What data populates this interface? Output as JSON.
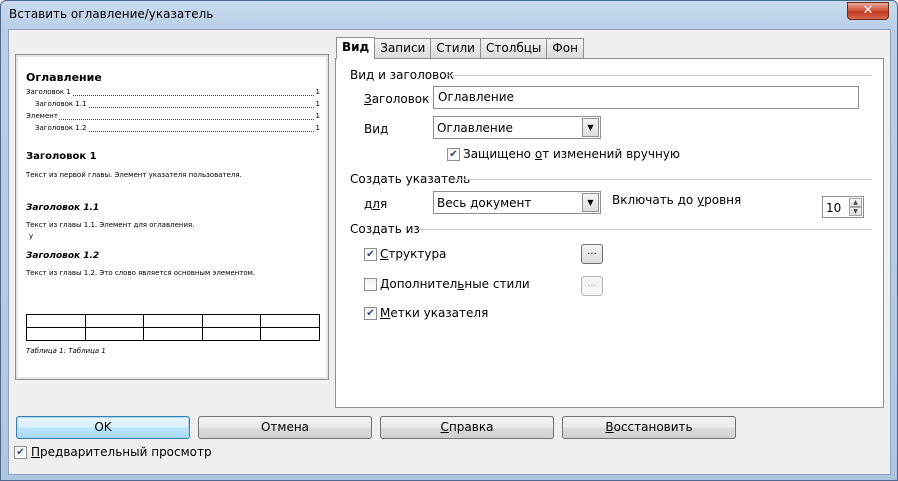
{
  "window": {
    "title": "Вставить оглавление/указатель",
    "close_glyph": "✕"
  },
  "preview": {
    "title": "Оглавление",
    "toc": [
      {
        "text": "Заголовок 1",
        "page": "1",
        "indent": 0
      },
      {
        "text": "Заголовок 1.1",
        "page": "1",
        "indent": 1
      },
      {
        "text": "Элемент",
        "page": "1",
        "indent": 0
      },
      {
        "text": "Заголовок 1.2",
        "page": "1",
        "indent": 1
      }
    ],
    "heading1": "Заголовок 1",
    "para1": "Текст из первой главы. Элемент указателя пользователя.",
    "heading11": "Заголовок 1.1",
    "para11": "Текст из главы 1.1. Элемент для оглавления.",
    "para11_marker": "у",
    "heading12": "Заголовок 1.2",
    "para12": "Текст из главы 1.2. Это слово является основным элементом.",
    "table_caption": "Таблица 1: Таблица 1"
  },
  "tabs": [
    "Вид",
    "Записи",
    "Стили",
    "Столбцы",
    "Фон"
  ],
  "active_tab": "Вид",
  "type_section": {
    "title": "Вид и заголовок",
    "heading_label_u": "З",
    "heading_label_rest": "аголовок",
    "heading_value": "Оглавление",
    "type_label": "Вид",
    "type_value": "Оглавление",
    "protected_label_pre": "Защищено ",
    "protected_label_u": "о",
    "protected_label_post": "т изменений вручную",
    "protected_checked": true
  },
  "index_section": {
    "title": "Создать указатель",
    "for_label_pre": "д",
    "for_label_u": "л",
    "for_label_post": "я",
    "for_value": "Весь документ",
    "level_label_pre": "Включать до ",
    "level_label_u": "у",
    "level_label_post": "ровня",
    "level_value": "10"
  },
  "create_from": {
    "title": "Создать из",
    "items": [
      {
        "label_u": "С",
        "label_rest": "труктура",
        "checked": true,
        "button": "...",
        "button_enabled": true
      },
      {
        "label_pre": "Дополнител",
        "label_u": "ь",
        "label_post": "ные стили",
        "checked": false,
        "button": "...",
        "button_enabled": false
      },
      {
        "label_u": "М",
        "label_rest": "етки указателя",
        "checked": true
      }
    ]
  },
  "buttons": {
    "ok": "OK",
    "cancel": "Отмена",
    "help_u": "С",
    "help_rest": "правка",
    "reset_u": "В",
    "reset_rest": "осстановить"
  },
  "preview_toggle": {
    "label_u": "П",
    "label_rest": "редварительный просмотр",
    "checked": true
  },
  "checkmark": "✔",
  "arrow_down": "▼",
  "arrow_up": "▲"
}
